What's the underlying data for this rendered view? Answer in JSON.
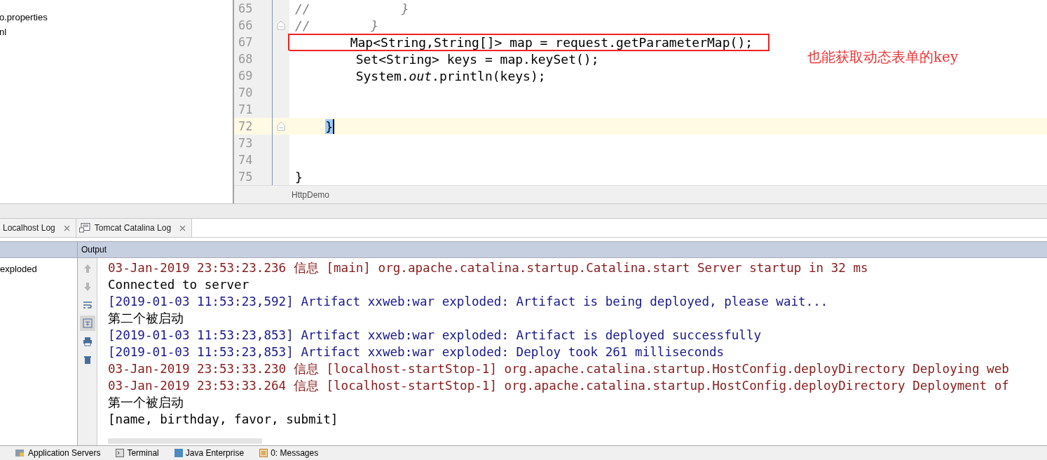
{
  "project_tree": {
    "items": [
      "o.properties",
      "nl"
    ]
  },
  "editor": {
    "lines": [
      {
        "number": "65",
        "text": "//            }",
        "comment": true
      },
      {
        "number": "66",
        "text": "//        }",
        "comment": true,
        "fold": true
      },
      {
        "number": "67",
        "text": "        Map<String,String[]> map = request.getParameterMap();",
        "boxed": true
      },
      {
        "number": "68",
        "text": "        Set<String> keys = map.keySet();"
      },
      {
        "number": "69",
        "text": "        System.*out*.println(keys);"
      },
      {
        "number": "70"
      },
      {
        "number": "71"
      },
      {
        "number": "72",
        "text": "    }",
        "fold": true,
        "current": true,
        "brace_highlighted": true
      },
      {
        "number": "73"
      },
      {
        "number": "74"
      },
      {
        "number": "75",
        "text": "}"
      }
    ],
    "annotation": "也能获取动态表单的key",
    "breadcrumb": "HttpDemo"
  },
  "log_tabs": [
    {
      "label": "Localhost Log",
      "icon": false
    },
    {
      "label": "Tomcat Catalina Log",
      "icon": true
    }
  ],
  "output_header": "Output",
  "deployment_item": "exploded",
  "console_lines": [
    {
      "kind": "stderr",
      "text": "03-Jan-2019 23:53:23.236 信息 [main] org.apache.catalina.startup.Catalina.start Server startup in 32 ms"
    },
    {
      "kind": "stdout",
      "text": "Connected to server"
    },
    {
      "kind": "system",
      "text": "[2019-01-03 11:53:23,592] Artifact xxweb:war exploded: Artifact is being deployed, please wait..."
    },
    {
      "kind": "stdout",
      "text": "第二个被启动"
    },
    {
      "kind": "system",
      "text": "[2019-01-03 11:53:23,853] Artifact xxweb:war exploded: Artifact is deployed successfully"
    },
    {
      "kind": "system",
      "text": "[2019-01-03 11:53:23,853] Artifact xxweb:war exploded: Deploy took 261 milliseconds"
    },
    {
      "kind": "stderr",
      "text": "03-Jan-2019 23:53:33.230 信息 [localhost-startStop-1] org.apache.catalina.startup.HostConfig.deployDirectory Deploying web"
    },
    {
      "kind": "stderr",
      "text": "03-Jan-2019 23:53:33.264 信息 [localhost-startStop-1] org.apache.catalina.startup.HostConfig.deployDirectory Deployment of"
    },
    {
      "kind": "stdout",
      "text": "第一个被启动"
    },
    {
      "kind": "stdout",
      "text": "[name, birthday, favor, submit]"
    }
  ],
  "console_tools": [
    {
      "kind": "up",
      "disabled": true,
      "selected": false
    },
    {
      "kind": "down",
      "disabled": true,
      "selected": false
    },
    {
      "kind": "wrap",
      "disabled": false,
      "selected": false
    },
    {
      "kind": "scroll",
      "disabled": false,
      "selected": true
    },
    {
      "kind": "print",
      "disabled": false,
      "selected": false
    },
    {
      "kind": "trash",
      "disabled": false,
      "selected": false
    }
  ],
  "bottom_tabs": [
    {
      "label": "Application Servers",
      "kind": "servers"
    },
    {
      "label": "Terminal",
      "kind": "terminal"
    },
    {
      "label": "Java Enterprise",
      "kind": "enterprise"
    },
    {
      "label": "0: Messages",
      "kind": "messages"
    }
  ]
}
